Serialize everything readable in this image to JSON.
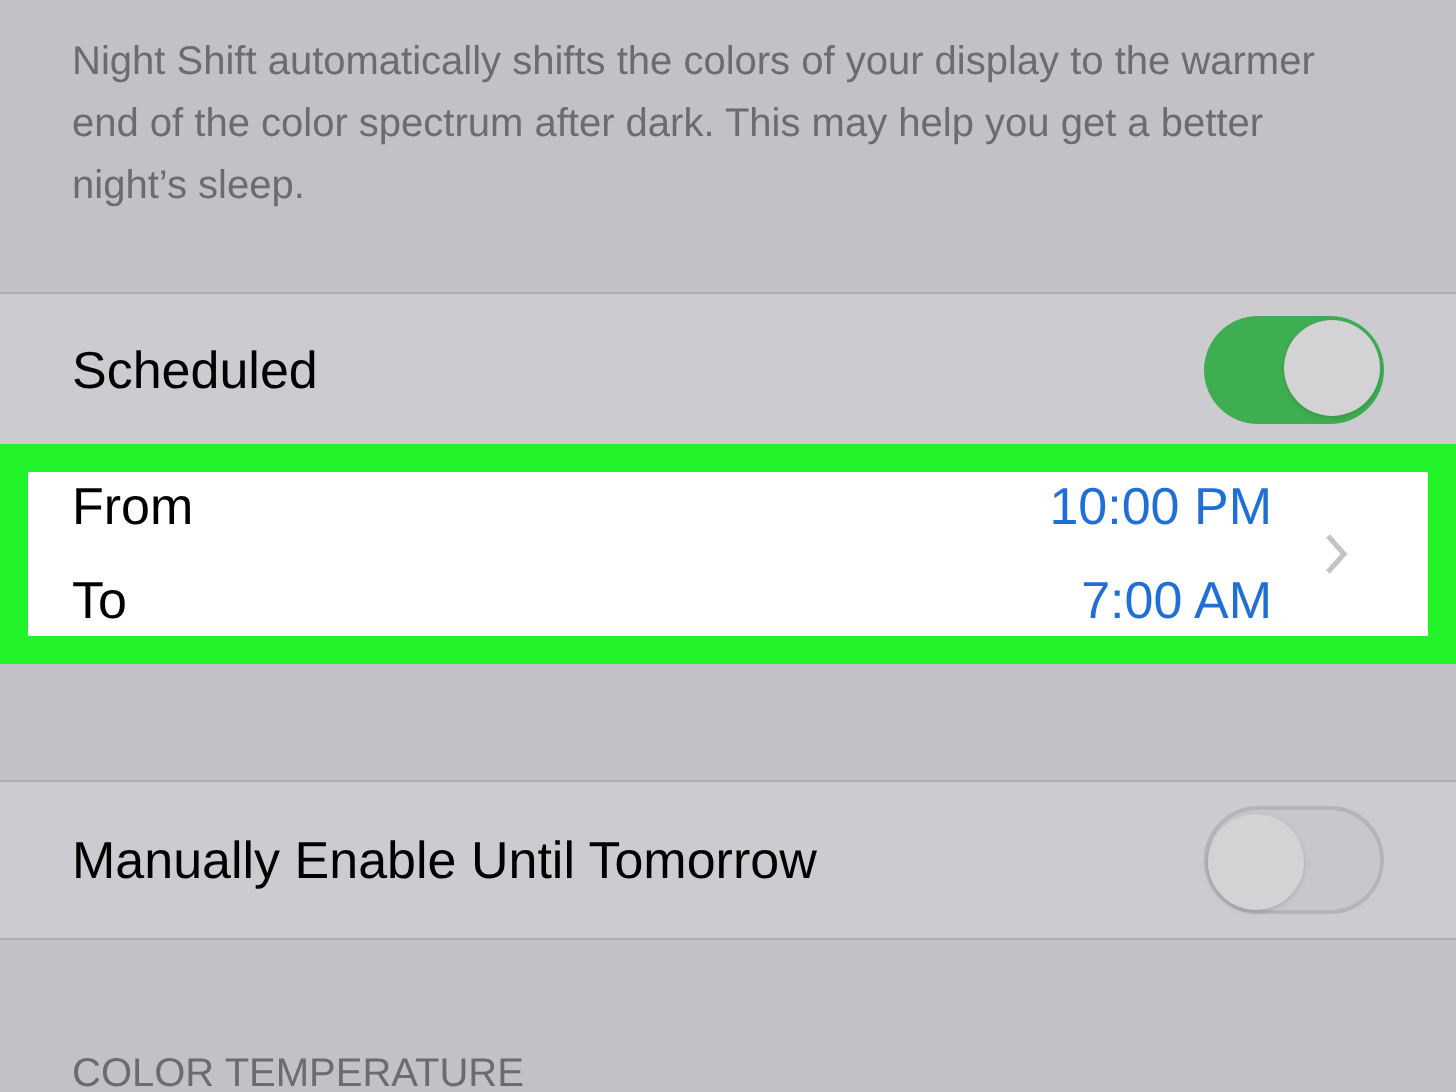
{
  "description": "Night Shift automatically shifts the colors of your display to the warmer end of the color spectrum after dark. This may help you get a better night’s sleep.",
  "scheduled": {
    "label": "Scheduled",
    "on": true
  },
  "schedule": {
    "highlighted": true,
    "from_label": "From",
    "from_value": "10:00 PM",
    "to_label": "To",
    "to_value": "7:00 AM"
  },
  "manual": {
    "label": "Manually Enable Until Tomorrow",
    "on": false
  },
  "section_header": "COLOR TEMPERATURE"
}
